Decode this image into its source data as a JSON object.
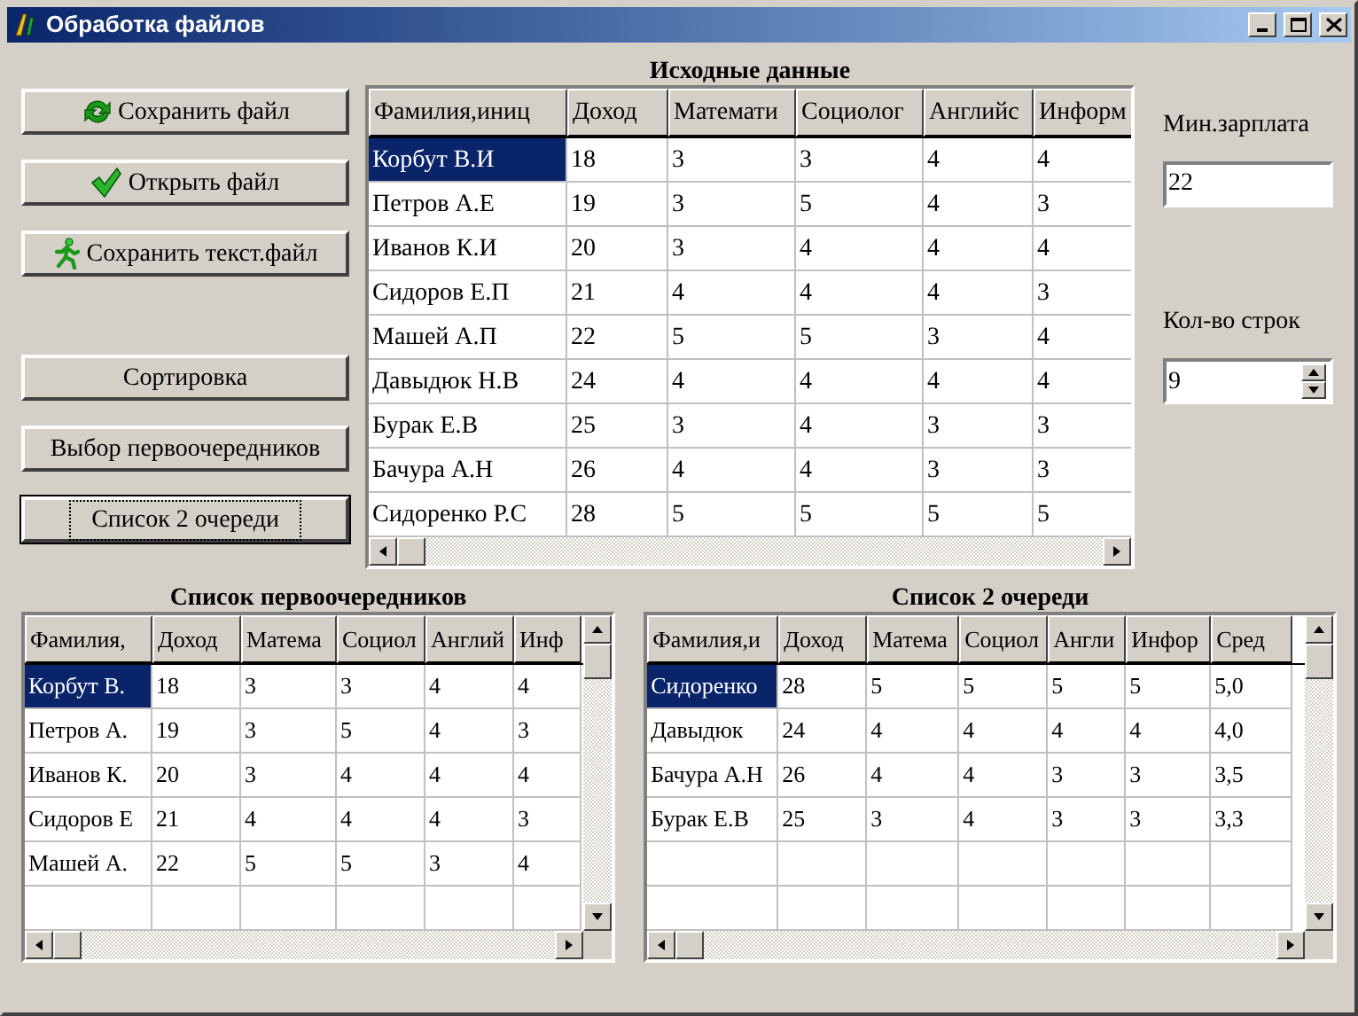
{
  "window": {
    "title": "Обработка файлов"
  },
  "buttons": [
    {
      "label": "Сохранить файл",
      "kind": "refresh",
      "focused": false
    },
    {
      "label": "Открыть файл",
      "kind": "check",
      "focused": false
    },
    {
      "label": "Сохранить текст.файл",
      "kind": "runner",
      "focused": false
    },
    {
      "label": "Сортировка",
      "focused": false
    },
    {
      "label": "Выбор первоочередников",
      "focused": false
    },
    {
      "label": "Список 2 очереди",
      "focused": true
    }
  ],
  "source": {
    "title": "Исходные данные",
    "columns": [
      "Фамилия,иниц",
      "Доход",
      "Математи",
      "Социолог",
      "Английс",
      "Информ"
    ],
    "rows": [
      {
        "cells": [
          "Корбут В.И",
          "18",
          "3",
          "3",
          "4",
          "4"
        ],
        "selected": true
      },
      {
        "cells": [
          "Петров  А.Е",
          "19",
          "3",
          "5",
          "4",
          "3"
        ],
        "selected": false
      },
      {
        "cells": [
          "Иванов К.И",
          "20",
          "3",
          "4",
          "4",
          "4"
        ],
        "selected": false
      },
      {
        "cells": [
          "Сидоров Е.П",
          "21",
          "4",
          "4",
          "4",
          "3"
        ],
        "selected": false
      },
      {
        "cells": [
          "Машей А.П",
          "22",
          "5",
          "5",
          "3",
          "4"
        ],
        "selected": false
      },
      {
        "cells": [
          "Давыдюк Н.В",
          "24",
          "4",
          "4",
          "4",
          "4"
        ],
        "selected": false
      },
      {
        "cells": [
          "Бурак Е.В",
          "25",
          "3",
          "4",
          "3",
          "3"
        ],
        "selected": false
      },
      {
        "cells": [
          "Бачура А.Н",
          "26",
          "4",
          "4",
          "3",
          "3"
        ],
        "selected": false
      },
      {
        "cells": [
          "Сидоренко Р.С",
          "28",
          "5",
          "5",
          "5",
          "5"
        ],
        "selected": false
      }
    ]
  },
  "first_list": {
    "title": "Список первоочередников",
    "columns": [
      "Фамилия,",
      "Доход",
      "Матема",
      "Социол",
      "Англий",
      "Инф"
    ],
    "rows": [
      {
        "cells": [
          "Корбут В.",
          "18",
          "3",
          "3",
          "4",
          "4"
        ],
        "selected": true
      },
      {
        "cells": [
          "Петров  А.",
          "19",
          "3",
          "5",
          "4",
          "3"
        ],
        "selected": false
      },
      {
        "cells": [
          "Иванов К.",
          "20",
          "3",
          "4",
          "4",
          "4"
        ],
        "selected": false
      },
      {
        "cells": [
          "Сидоров Е",
          "21",
          "4",
          "4",
          "4",
          "3"
        ],
        "selected": false
      },
      {
        "cells": [
          "Машей А.",
          "22",
          "5",
          "5",
          "3",
          "4"
        ],
        "selected": false
      }
    ]
  },
  "second_list": {
    "title": "Список 2 очереди",
    "columns": [
      "Фамилия,и",
      "Доход",
      "Матема",
      "Социол",
      "Англи",
      "Инфор",
      "Сред"
    ],
    "rows": [
      {
        "cells": [
          "Сидоренко",
          "28",
          "5",
          "5",
          "5",
          "5",
          "5,0"
        ],
        "selected": true
      },
      {
        "cells": [
          "Давыдюк",
          "24",
          "4",
          "4",
          "4",
          "4",
          "4,0"
        ],
        "selected": false
      },
      {
        "cells": [
          "Бачура А.Н",
          "26",
          "4",
          "4",
          "3",
          "3",
          "3,5"
        ],
        "selected": false
      },
      {
        "cells": [
          "Бурак Е.В",
          "25",
          "3",
          "4",
          "3",
          "3",
          "3,3"
        ],
        "selected": false
      }
    ]
  },
  "min_salary": {
    "label": "Мин.зарплата",
    "value": "22"
  },
  "row_count": {
    "label": "Кол-во строк",
    "value": "9"
  }
}
